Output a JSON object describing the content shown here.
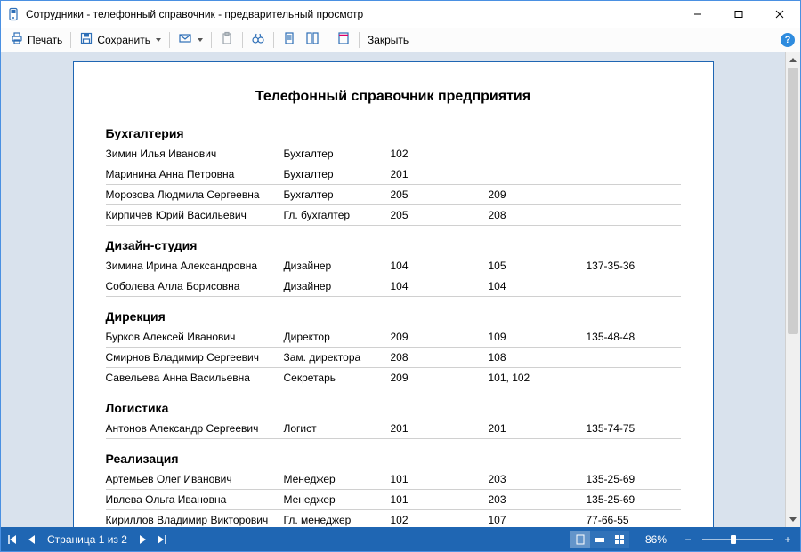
{
  "window": {
    "title": "Сотрудники - телефонный справочник - предварительный просмотр"
  },
  "toolbar": {
    "print": "Печать",
    "save": "Сохранить",
    "close": "Закрыть"
  },
  "status": {
    "page_label": "Страница 1 из 2",
    "zoom_pct": "86%"
  },
  "doc": {
    "title": "Телефонный справочник предприятия",
    "departments": [
      {
        "name": "Бухгалтерия",
        "rows": [
          {
            "name": "Зимин Илья Иванович",
            "pos": "Бухгалтер",
            "p1": "102",
            "p2": "",
            "p3": ""
          },
          {
            "name": "Маринина Анна Петровна",
            "pos": "Бухгалтер",
            "p1": "201",
            "p2": "",
            "p3": ""
          },
          {
            "name": "Морозова Людмила Сергеевна",
            "pos": "Бухгалтер",
            "p1": "205",
            "p2": "209",
            "p3": ""
          },
          {
            "name": "Кирпичев Юрий Васильевич",
            "pos": "Гл. бухгалтер",
            "p1": "205",
            "p2": "208",
            "p3": ""
          }
        ]
      },
      {
        "name": "Дизайн-студия",
        "rows": [
          {
            "name": "Зимина Ирина Александровна",
            "pos": "Дизайнер",
            "p1": "104",
            "p2": "105",
            "p3": "137-35-36"
          },
          {
            "name": "Соболева Алла Борисовна",
            "pos": "Дизайнер",
            "p1": "104",
            "p2": "104",
            "p3": ""
          }
        ]
      },
      {
        "name": "Дирекция",
        "rows": [
          {
            "name": "Бурков Алексей Иванович",
            "pos": "Директор",
            "p1": "209",
            "p2": "109",
            "p3": "135-48-48"
          },
          {
            "name": "Смирнов Владимир Сергеевич",
            "pos": "Зам. директора",
            "p1": "208",
            "p2": "108",
            "p3": ""
          },
          {
            "name": "Савельева Анна Васильевна",
            "pos": "Секретарь",
            "p1": "209",
            "p2": "101, 102",
            "p3": ""
          }
        ]
      },
      {
        "name": "Логистика",
        "rows": [
          {
            "name": "Антонов Александр Сергеевич",
            "pos": "Логист",
            "p1": "201",
            "p2": "201",
            "p3": "135-74-75"
          }
        ]
      },
      {
        "name": "Реализация",
        "rows": [
          {
            "name": "Артемьев Олег Иванович",
            "pos": "Менеджер",
            "p1": "101",
            "p2": "203",
            "p3": "135-25-69"
          },
          {
            "name": "Ивлева Ольга Ивановна",
            "pos": "Менеджер",
            "p1": "101",
            "p2": "203",
            "p3": "135-25-69"
          },
          {
            "name": "Кириллов Владимир Викторович",
            "pos": "Гл. менеджер",
            "p1": "102",
            "p2": "107",
            "p3": "77-66-55"
          }
        ]
      }
    ]
  }
}
